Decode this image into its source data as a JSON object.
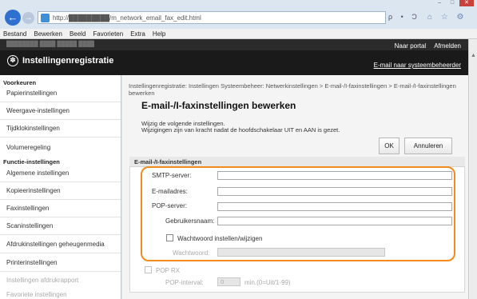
{
  "browser": {
    "address": "http://█████████/m_network_email_fax_edit.html",
    "address_controls": "ρ • Ɔ",
    "menu": [
      "Bestand",
      "Bewerken",
      "Beeld",
      "Favorieten",
      "Extra",
      "Help"
    ]
  },
  "header": {
    "top_text": "████████  ████  █████  ████",
    "portal_link": "Naar portal",
    "logout_link": "Afmelden",
    "app_title": "Instellingenregistratie",
    "email_link": "E-mail naar systeembeheerder"
  },
  "sidebar": {
    "section1": "Voorkeuren",
    "section1_items": [
      "Papierinstellingen",
      "Weergave-instellingen",
      "Tijdklokinstellingen",
      "Volumeregeling"
    ],
    "section2": "Functie-instellingen",
    "section2_items": [
      "Algemene instellingen",
      "Kopieerinstellingen",
      "Faxinstellingen",
      "Scaninstellingen",
      "Afdrukinstellingen geheugenmedia",
      "Printerinstellingen",
      "Instellingen afdrukrapport",
      "Favoriete instellingen"
    ]
  },
  "main": {
    "breadcrumb": "Instellingenregistratie: Instellingen Systeembeheer: Netwerkinstellingen > E-mail-/I-faxinstellingen > E-mail-/I-faxinstellingen bewerken",
    "title": "E-mail-/I-faxinstellingen bewerken",
    "info1": "Wijzig de volgende instellingen.",
    "info2": "Wijzigingen zijn van kracht nadat de hoofdschakelaar UIT en AAN is gezet.",
    "ok_label": "OK",
    "cancel_label": "Annuleren",
    "section_title": "E-mail-/I-faxinstellingen",
    "fields": {
      "smtp_label": "SMTP-server:",
      "email_label": "E-mailadres:",
      "pop_label": "POP-server:",
      "user_label": "Gebruikersnaam:",
      "pw_check_label": "Wachtwoord instellen/wijzigen",
      "pw_label": "Wachtwoord:",
      "poprx_label": "POP RX",
      "popinterval_label": "POP-interval:",
      "popinterval_value": "0",
      "popinterval_unit": "min.(0=Uit/1-99)"
    }
  }
}
